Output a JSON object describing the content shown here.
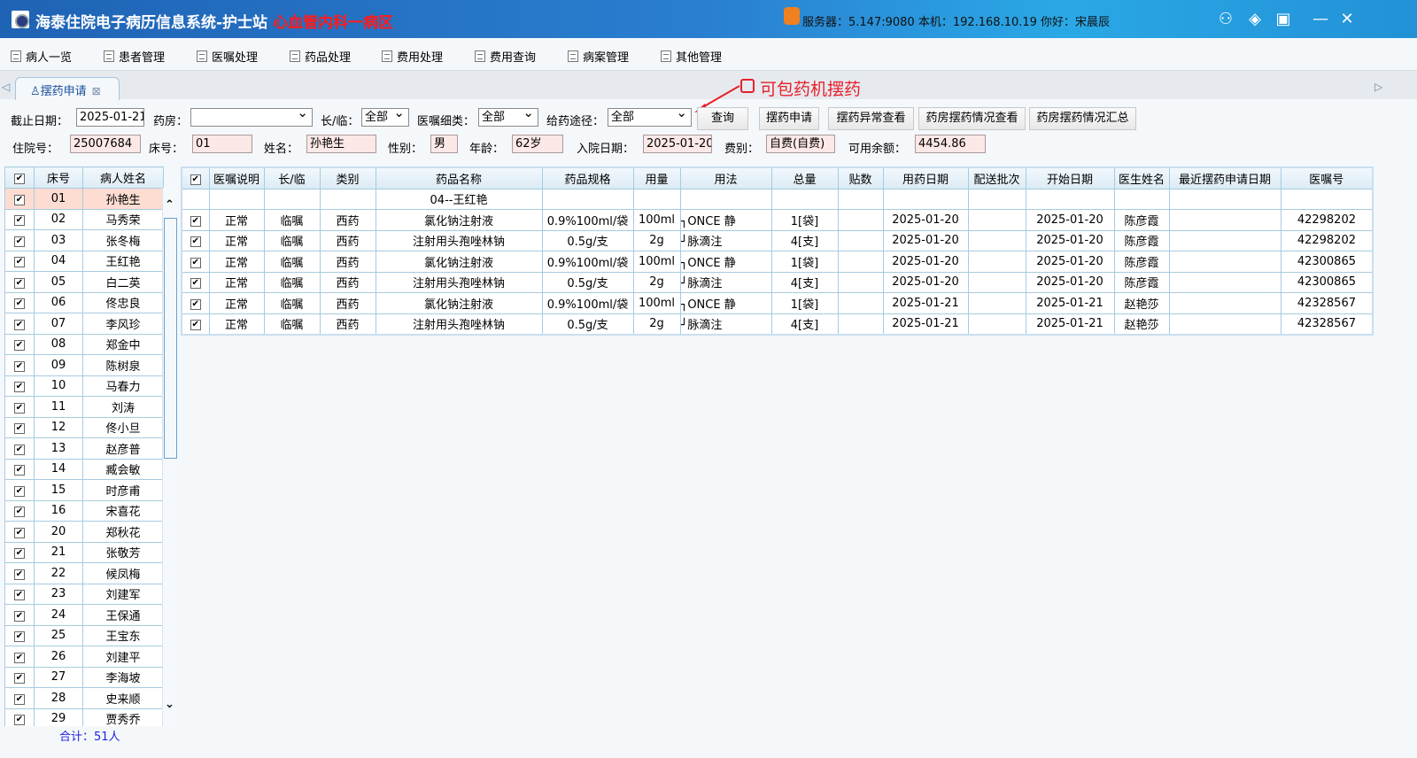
{
  "app": {
    "title": "海泰住院电子病历信息系统-护士站",
    "department": "心血管内科一病区",
    "server_info": "服务器：5.147:9080 本机：192.168.10.19 你好：宋晨辰"
  },
  "menu": [
    "病人一览",
    "患者管理",
    "医嘱处理",
    "药品处理",
    "费用处理",
    "费用查询",
    "病案管理",
    "其他管理"
  ],
  "tab": {
    "label": "摆药申请"
  },
  "annotation": "可包药机摆药",
  "filters": {
    "end_date_label": "截止日期：",
    "end_date": "2025-01-21",
    "pharmacy_label": "药房：",
    "pharmacy": "",
    "long_temp_label": "长/临：",
    "long_temp": "全部",
    "order_type_label": "医嘱细类：",
    "order_type": "全部",
    "route_label": "给药途径：",
    "route": "全部"
  },
  "buttons": [
    "查询",
    "摆药申请",
    "摆药异常查看",
    "药房摆药情况查看",
    "药房摆药情况汇总"
  ],
  "patient": {
    "inpatient_no_label": "住院号：",
    "inpatient_no": "25007684",
    "bed_label": "床号：",
    "bed": "01",
    "name_label": "姓名：",
    "name": "孙艳生",
    "sex_label": "性别：",
    "sex": "男",
    "age_label": "年龄：",
    "age": "62岁",
    "admit_label": "入院日期：",
    "admit_date": "2025-01-20",
    "fee_label": "费别：",
    "fee_type": "自费(自费)",
    "balance_label": "可用余额：",
    "balance": "4454.86"
  },
  "patient_list": {
    "headers": [
      "床号",
      "病人姓名"
    ],
    "rows": [
      [
        "01",
        "孙艳生"
      ],
      [
        "02",
        "马秀荣"
      ],
      [
        "03",
        "张冬梅"
      ],
      [
        "04",
        "王红艳"
      ],
      [
        "05",
        "白二英"
      ],
      [
        "06",
        "佟忠良"
      ],
      [
        "07",
        "李风珍"
      ],
      [
        "08",
        "郑金中"
      ],
      [
        "09",
        "陈树泉"
      ],
      [
        "10",
        "马春力"
      ],
      [
        "11",
        "刘涛"
      ],
      [
        "12",
        "佟小旦"
      ],
      [
        "13",
        "赵彦普"
      ],
      [
        "14",
        "臧会敏"
      ],
      [
        "15",
        "时彦甫"
      ],
      [
        "16",
        "宋喜花"
      ],
      [
        "20",
        "郑秋花"
      ],
      [
        "21",
        "张敬芳"
      ],
      [
        "22",
        "候凤梅"
      ],
      [
        "23",
        "刘建军"
      ],
      [
        "24",
        "王保通"
      ],
      [
        "25",
        "王宝东"
      ],
      [
        "26",
        "刘建平"
      ],
      [
        "27",
        "李海坡"
      ],
      [
        "28",
        "史来顺"
      ],
      [
        "29",
        "贾秀乔"
      ]
    ],
    "total": "合计：51人"
  },
  "orders": {
    "headers": [
      "医嘱说明",
      "长/临",
      "类别",
      "药品名称",
      "药品规格",
      "用量",
      "用法",
      "总量",
      "贴数",
      "用药日期",
      "配送批次",
      "开始日期",
      "医生姓名",
      "最近摆药申请日期",
      "医嘱号"
    ],
    "group_label": "04--王红艳",
    "rows": [
      [
        "正常",
        "临嘱",
        "西药",
        "氯化钠注射液",
        "0.9%100ml/袋",
        "100ml",
        "┐ONCE 静",
        "1[袋]",
        "",
        "2025-01-20",
        "",
        "2025-01-20",
        "陈彦霞",
        "",
        "42298202"
      ],
      [
        "正常",
        "临嘱",
        "西药",
        "注射用头孢唑林钠",
        "0.5g/支",
        "2g",
        "┘脉滴注",
        "4[支]",
        "",
        "2025-01-20",
        "",
        "2025-01-20",
        "陈彦霞",
        "",
        "42298202"
      ],
      [
        "正常",
        "临嘱",
        "西药",
        "氯化钠注射液",
        "0.9%100ml/袋",
        "100ml",
        "┐ONCE 静",
        "1[袋]",
        "",
        "2025-01-20",
        "",
        "2025-01-20",
        "陈彦霞",
        "",
        "42300865"
      ],
      [
        "正常",
        "临嘱",
        "西药",
        "注射用头孢唑林钠",
        "0.5g/支",
        "2g",
        "┘脉滴注",
        "4[支]",
        "",
        "2025-01-20",
        "",
        "2025-01-20",
        "陈彦霞",
        "",
        "42300865"
      ],
      [
        "正常",
        "临嘱",
        "西药",
        "氯化钠注射液",
        "0.9%100ml/袋",
        "100ml",
        "┐ONCE 静",
        "1[袋]",
        "",
        "2025-01-21",
        "",
        "2025-01-21",
        "赵艳莎",
        "",
        "42328567"
      ],
      [
        "正常",
        "临嘱",
        "西药",
        "注射用头孢唑林钠",
        "0.5g/支",
        "2g",
        "┘脉滴注",
        "4[支]",
        "",
        "2025-01-21",
        "",
        "2025-01-21",
        "赵艳莎",
        "",
        "42328567"
      ]
    ]
  }
}
